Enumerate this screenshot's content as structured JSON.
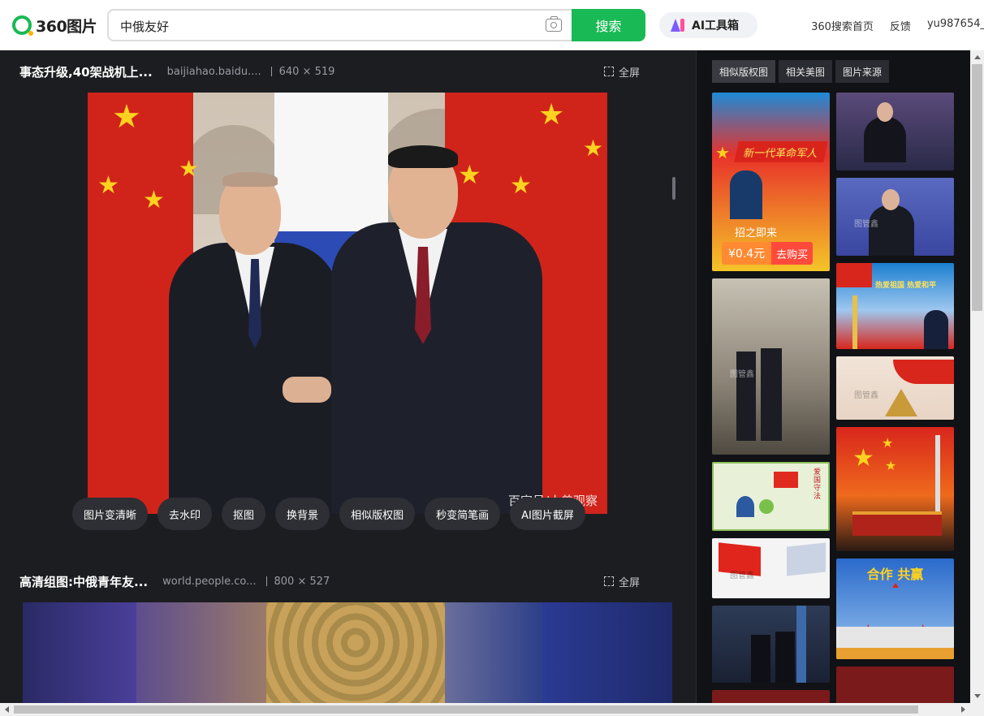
{
  "header": {
    "logo_text": "360图片",
    "search_value": "中俄友好",
    "search_button": "搜索",
    "ai_tool_label": "AI工具箱",
    "links": [
      "360搜索首页",
      "反馈",
      "yu987654_"
    ]
  },
  "results": [
    {
      "title": "事态升级,40架战机上...",
      "source": "baijiahao.baidu....",
      "size": "640 × 519",
      "fullscreen": "全屏",
      "watermark": "百家号/小曾观察"
    },
    {
      "title": "高清组图:中俄青年友...",
      "source": "world.people.co...",
      "size": "800 × 527",
      "fullscreen": "全屏"
    }
  ],
  "tools": [
    "图片变清晰",
    "去水印",
    "抠图",
    "换背景",
    "相似版权图",
    "秒变简笔画",
    "AI图片截屏"
  ],
  "side": {
    "tabs": [
      "相似版权图",
      "相关美图",
      "图片来源"
    ],
    "ad": {
      "banner": "新一代革命军人",
      "slogan": "招之即来",
      "price": "¥0.4元",
      "buy": "去购买"
    },
    "thumb_texts": {
      "poster_red": "热爱祖国 热爱和平",
      "panel_hand": "合作 共赢",
      "cartoon_badge": "爱国守法"
    },
    "watermark": "图管鑫"
  },
  "colors": {
    "accent": "#19b955",
    "background": "#1c1d21",
    "side_background": "#111215"
  }
}
